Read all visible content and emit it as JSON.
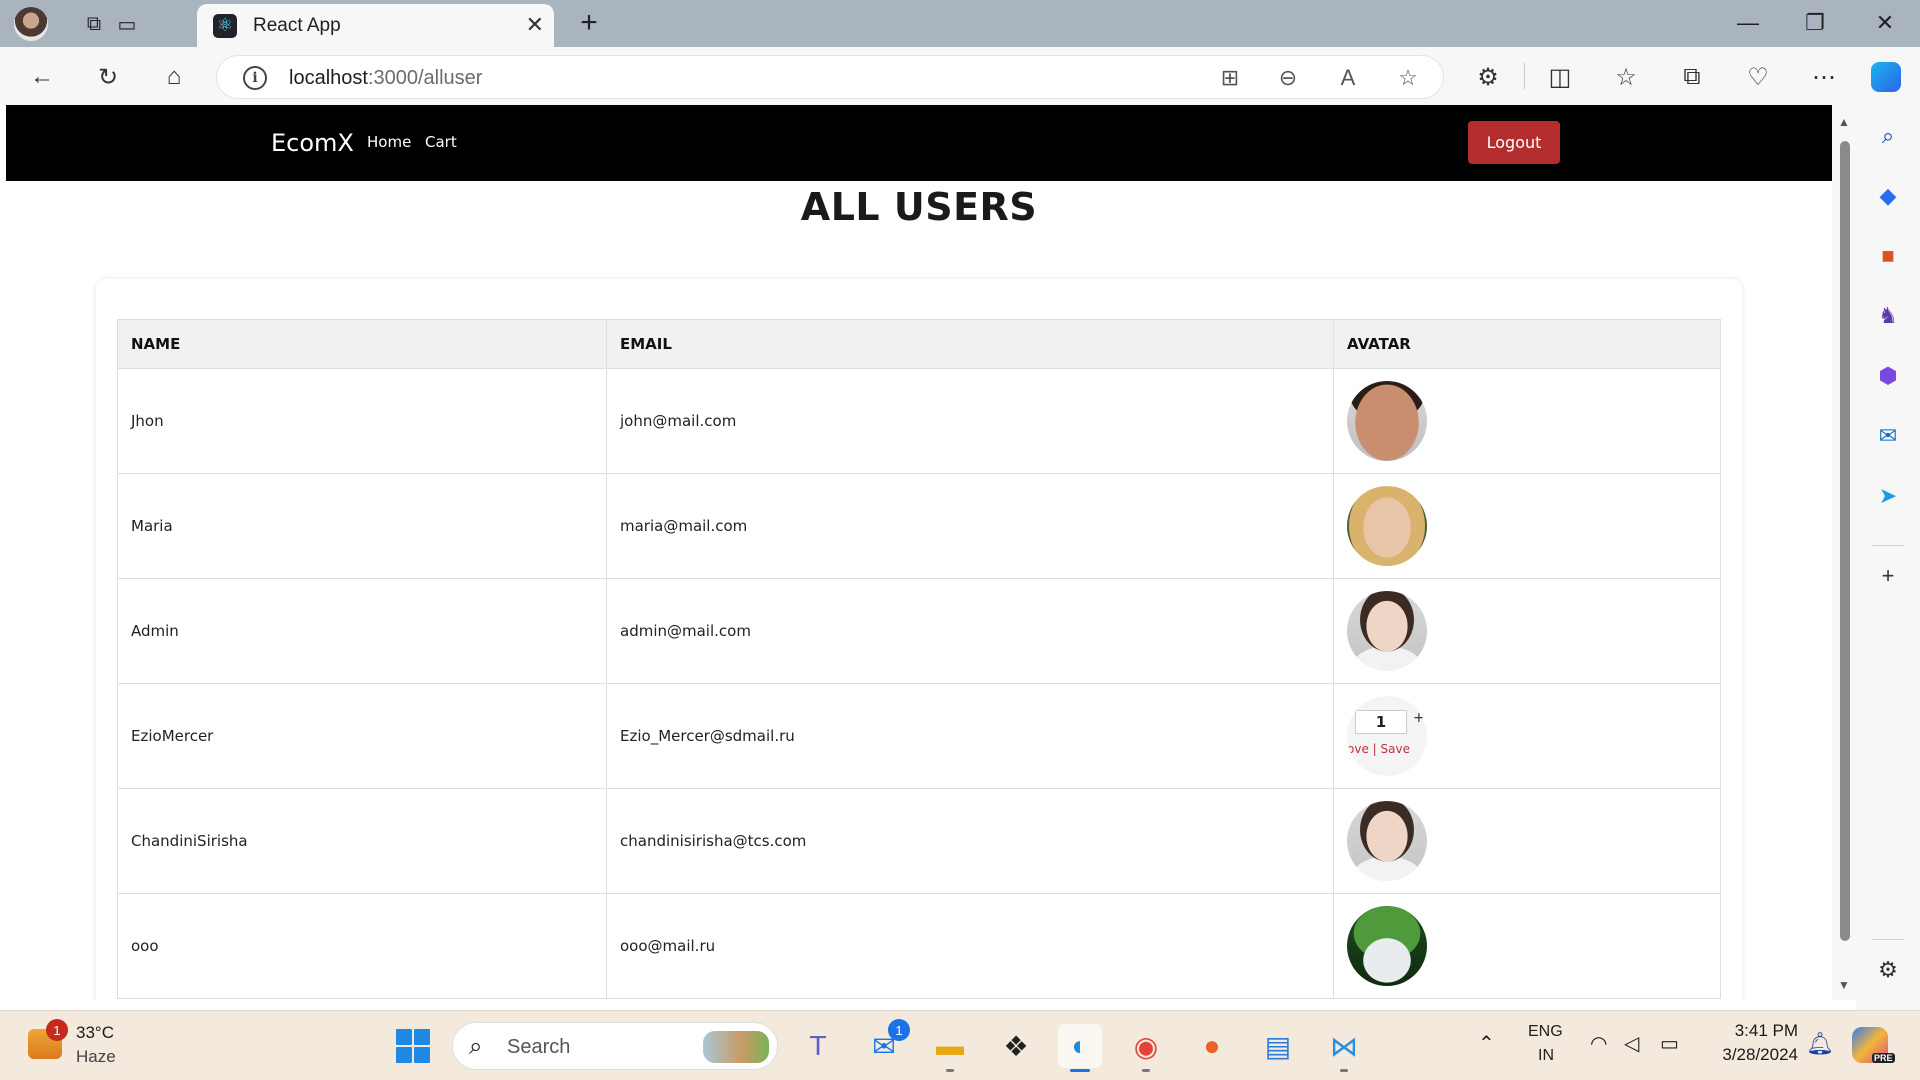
{
  "browser": {
    "tab_title": "React App",
    "tab_close": "✕",
    "new_tab": "+",
    "url_host": "localhost",
    "url_path": ":3000/alluser",
    "win_minimize": "—",
    "win_restore": "❐",
    "win_close": "✕"
  },
  "navbar": {
    "brand": "EcomX",
    "links": [
      "Home",
      "Cart"
    ],
    "logout_label": "Logout"
  },
  "page": {
    "title": "ALL USERS"
  },
  "table": {
    "headers": [
      "NAME",
      "EMAIL",
      "AVATAR"
    ],
    "rows": [
      {
        "name": "Jhon",
        "email": "john@mail.com",
        "avatar": "photo-man"
      },
      {
        "name": "Maria",
        "email": "maria@mail.com",
        "avatar": "photo-blonde-woman"
      },
      {
        "name": "Admin",
        "email": "admin@mail.com",
        "avatar": "photo-woman"
      },
      {
        "name": "EzioMercer",
        "email": "Ezio_Mercer@sdmail.ru",
        "avatar": "cart-widget"
      },
      {
        "name": "ChandiniSirisha",
        "email": "chandinisirisha@tcs.com",
        "avatar": "photo-woman"
      },
      {
        "name": "ooo",
        "email": "ooo@mail.ru",
        "avatar": "frog-hat-cat"
      }
    ],
    "widget": {
      "qty": "1",
      "plus": "+",
      "links": "ove | Save"
    }
  },
  "taskbar": {
    "weather_badge": "1",
    "temperature": "33°C",
    "condition": "Haze",
    "search_placeholder": "Search",
    "mail_badge": "1",
    "lang_line1": "ENG",
    "lang_line2": "IN",
    "time": "3:41 PM",
    "date": "3/28/2024",
    "copilot_tag": "PRE"
  },
  "colors": {
    "navbar_bg": "#000000",
    "logout_bg": "#b32d2e",
    "table_header_bg": "#f1f1f1",
    "taskbar_bg": "#f3e9dc"
  }
}
